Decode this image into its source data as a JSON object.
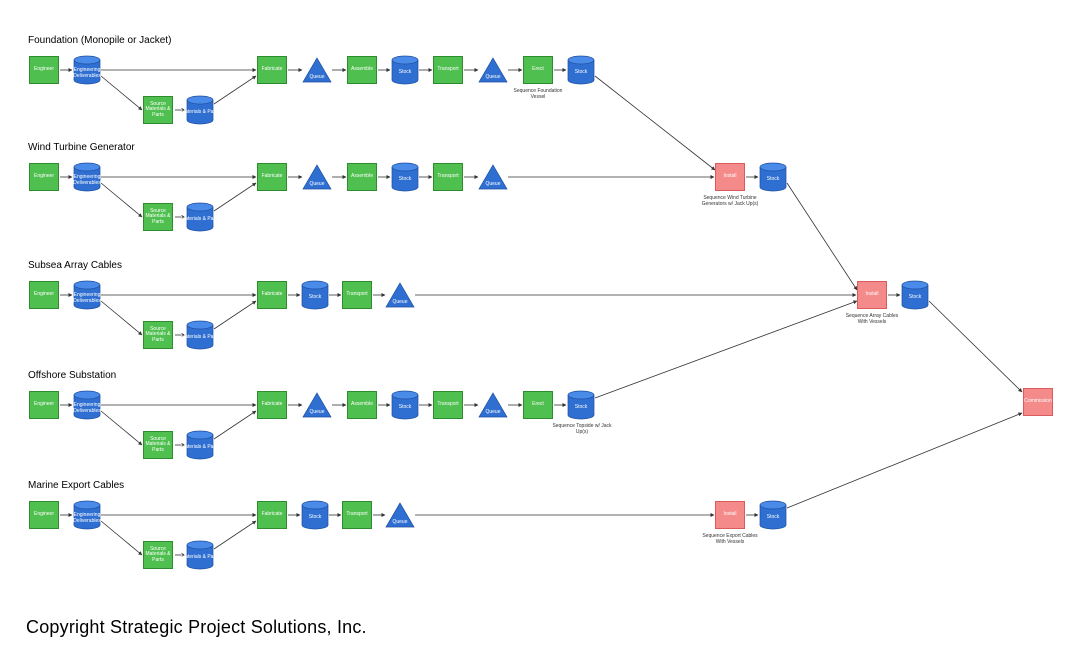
{
  "lanes": {
    "foundation": {
      "title": "Foundation (Monopile or Jacket)"
    },
    "wtg": {
      "title": "Wind Turbine Generator"
    },
    "arrayCables": {
      "title": "Subsea Array Cables"
    },
    "substation": {
      "title": "Offshore Substation"
    },
    "exportCables": {
      "title": "Marine Export Cables"
    }
  },
  "labels": {
    "engineer": "Engineer",
    "engineeringDeliverables": "Engineering Deliverables",
    "sourceMaterialsParts": "Source Materials & Parts",
    "materialsParts": "Materials & Parts",
    "fabricate": "Fabricate",
    "queue": "Queue",
    "assemble": "Assemble",
    "stock": "Stock",
    "transport": "Transport",
    "erect": "Erect",
    "install": "Install",
    "commission": "Commission"
  },
  "notes": {
    "foundationErect": "Sequence Foundation Vessel",
    "wtgInstall": "Sequence Wind Turbine Generators w/ Jack Up(s)",
    "arrayInstall": "Sequence Array Cables With Vessels",
    "substationErect": "Sequence Topside w/ Jack Up(s)",
    "exportInstall": "Sequence Export Cables With Vessels"
  },
  "copyright": "Copyright Strategic Project Solutions, Inc."
}
